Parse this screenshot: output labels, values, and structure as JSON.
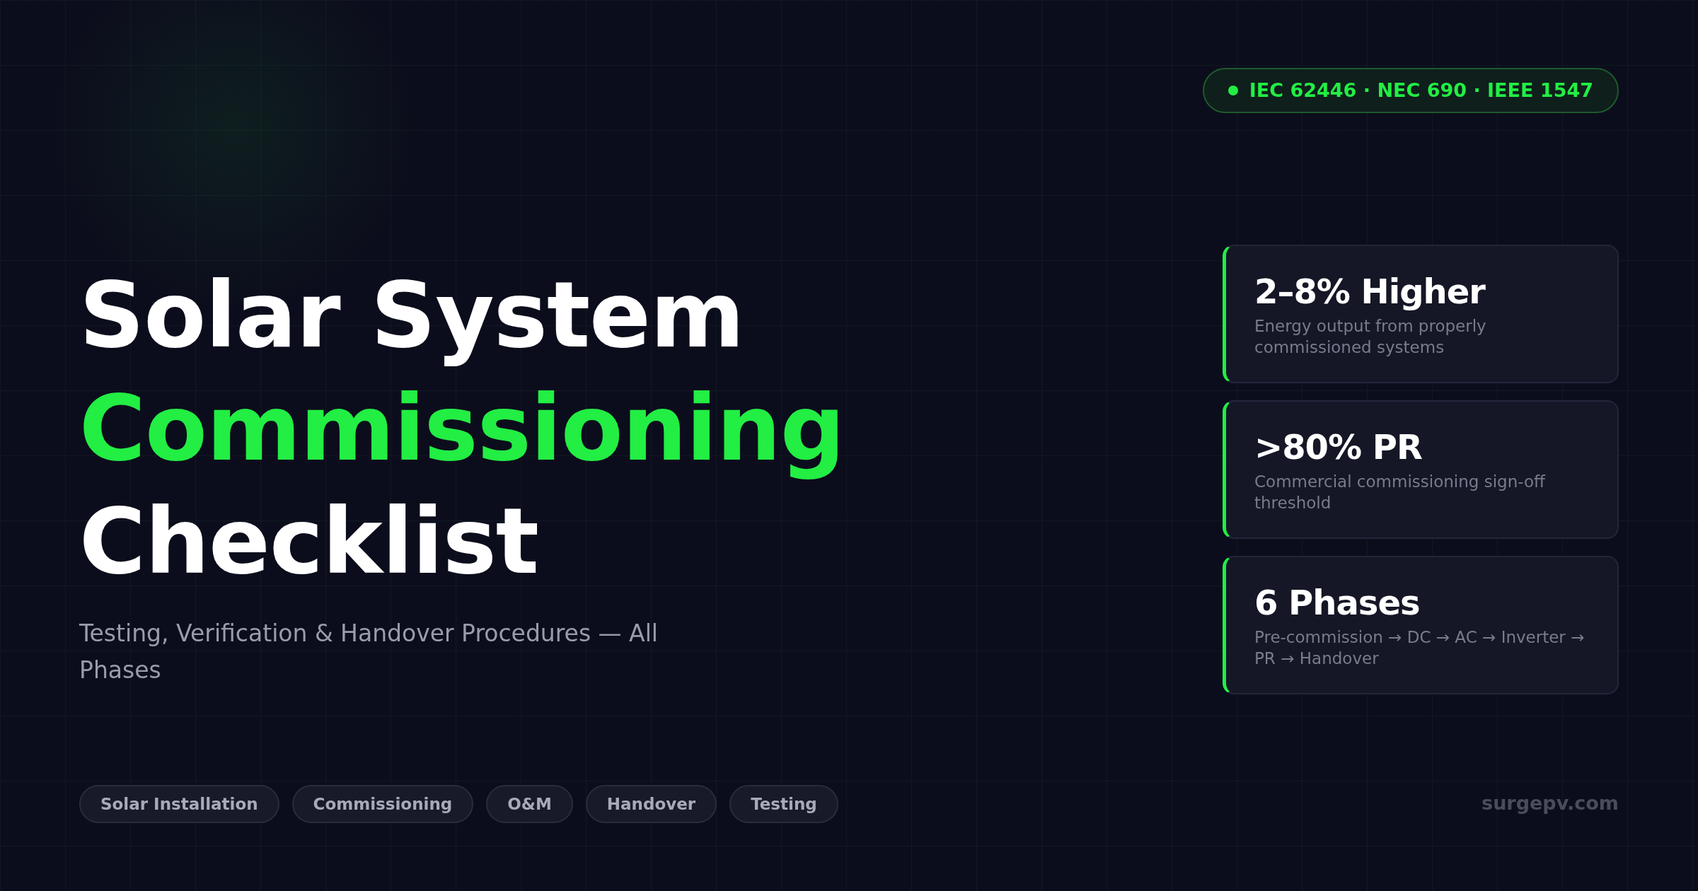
{
  "badge": {
    "text": "IEC 62446 · NEC 690 · IEEE 1547",
    "color": "#22ee44"
  },
  "title": {
    "line_1": "Solar System",
    "line_2": "Commissioning",
    "line_3": "Checklist"
  },
  "subtitle": "Testing, Verification & Handover Procedures — All Phases",
  "stats": [
    {
      "value": "2–8% Higher",
      "caption": "Energy output from properly commissioned systems"
    },
    {
      "value": ">80% PR",
      "caption": "Commercial commissioning sign-off threshold"
    },
    {
      "value": "6 Phases",
      "caption": "Pre-commission → DC → AC → Inverter → PR → Handover"
    }
  ],
  "tags": [
    "Solar Installation",
    "Commissioning",
    "O&M",
    "Handover",
    "Testing"
  ],
  "footer": "surgepv.com"
}
